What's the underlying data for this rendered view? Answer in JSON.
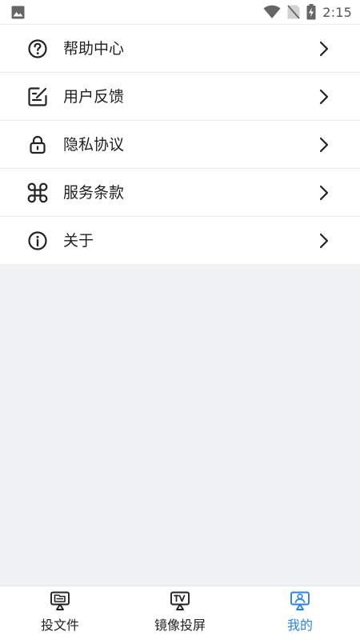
{
  "status_bar": {
    "time": "2:15",
    "icons": [
      "image-icon",
      "wifi-icon",
      "no-sim-icon",
      "battery-charging-icon"
    ]
  },
  "menu": {
    "items": [
      {
        "label": "帮助中心",
        "icon": "help-circle-icon"
      },
      {
        "label": "用户反馈",
        "icon": "feedback-edit-icon"
      },
      {
        "label": "隐私协议",
        "icon": "lock-icon"
      },
      {
        "label": "服务条款",
        "icon": "command-icon"
      },
      {
        "label": "关于",
        "icon": "info-circle-icon"
      }
    ]
  },
  "bottom_nav": {
    "items": [
      {
        "label": "投文件",
        "icon": "cast-file-icon",
        "active": false
      },
      {
        "label": "镜像投屏",
        "icon": "cast-tv-icon",
        "active": false
      },
      {
        "label": "我的",
        "icon": "cast-user-icon",
        "active": true
      }
    ]
  },
  "colors": {
    "accent": "#2a84e5",
    "background": "#f0f1f3",
    "surface": "#ffffff",
    "text": "#1f1f1f"
  }
}
